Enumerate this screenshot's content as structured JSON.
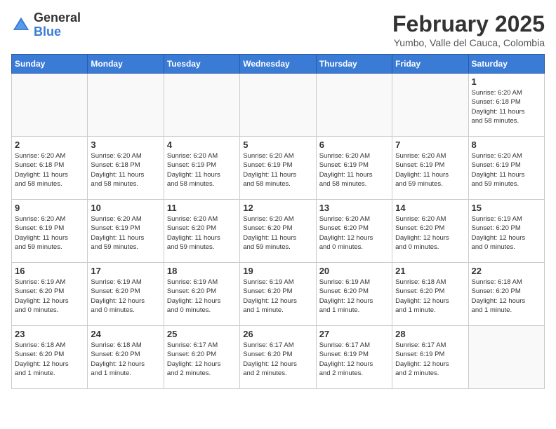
{
  "header": {
    "logo": {
      "general": "General",
      "blue": "Blue"
    },
    "title": "February 2025",
    "subtitle": "Yumbo, Valle del Cauca, Colombia"
  },
  "weekdays": [
    "Sunday",
    "Monday",
    "Tuesday",
    "Wednesday",
    "Thursday",
    "Friday",
    "Saturday"
  ],
  "weeks": [
    [
      {
        "day": "",
        "info": ""
      },
      {
        "day": "",
        "info": ""
      },
      {
        "day": "",
        "info": ""
      },
      {
        "day": "",
        "info": ""
      },
      {
        "day": "",
        "info": ""
      },
      {
        "day": "",
        "info": ""
      },
      {
        "day": "1",
        "info": "Sunrise: 6:20 AM\nSunset: 6:18 PM\nDaylight: 11 hours\nand 58 minutes."
      }
    ],
    [
      {
        "day": "2",
        "info": "Sunrise: 6:20 AM\nSunset: 6:18 PM\nDaylight: 11 hours\nand 58 minutes."
      },
      {
        "day": "3",
        "info": "Sunrise: 6:20 AM\nSunset: 6:18 PM\nDaylight: 11 hours\nand 58 minutes."
      },
      {
        "day": "4",
        "info": "Sunrise: 6:20 AM\nSunset: 6:19 PM\nDaylight: 11 hours\nand 58 minutes."
      },
      {
        "day": "5",
        "info": "Sunrise: 6:20 AM\nSunset: 6:19 PM\nDaylight: 11 hours\nand 58 minutes."
      },
      {
        "day": "6",
        "info": "Sunrise: 6:20 AM\nSunset: 6:19 PM\nDaylight: 11 hours\nand 58 minutes."
      },
      {
        "day": "7",
        "info": "Sunrise: 6:20 AM\nSunset: 6:19 PM\nDaylight: 11 hours\nand 59 minutes."
      },
      {
        "day": "8",
        "info": "Sunrise: 6:20 AM\nSunset: 6:19 PM\nDaylight: 11 hours\nand 59 minutes."
      }
    ],
    [
      {
        "day": "9",
        "info": "Sunrise: 6:20 AM\nSunset: 6:19 PM\nDaylight: 11 hours\nand 59 minutes."
      },
      {
        "day": "10",
        "info": "Sunrise: 6:20 AM\nSunset: 6:19 PM\nDaylight: 11 hours\nand 59 minutes."
      },
      {
        "day": "11",
        "info": "Sunrise: 6:20 AM\nSunset: 6:20 PM\nDaylight: 11 hours\nand 59 minutes."
      },
      {
        "day": "12",
        "info": "Sunrise: 6:20 AM\nSunset: 6:20 PM\nDaylight: 11 hours\nand 59 minutes."
      },
      {
        "day": "13",
        "info": "Sunrise: 6:20 AM\nSunset: 6:20 PM\nDaylight: 12 hours\nand 0 minutes."
      },
      {
        "day": "14",
        "info": "Sunrise: 6:20 AM\nSunset: 6:20 PM\nDaylight: 12 hours\nand 0 minutes."
      },
      {
        "day": "15",
        "info": "Sunrise: 6:19 AM\nSunset: 6:20 PM\nDaylight: 12 hours\nand 0 minutes."
      }
    ],
    [
      {
        "day": "16",
        "info": "Sunrise: 6:19 AM\nSunset: 6:20 PM\nDaylight: 12 hours\nand 0 minutes."
      },
      {
        "day": "17",
        "info": "Sunrise: 6:19 AM\nSunset: 6:20 PM\nDaylight: 12 hours\nand 0 minutes."
      },
      {
        "day": "18",
        "info": "Sunrise: 6:19 AM\nSunset: 6:20 PM\nDaylight: 12 hours\nand 0 minutes."
      },
      {
        "day": "19",
        "info": "Sunrise: 6:19 AM\nSunset: 6:20 PM\nDaylight: 12 hours\nand 1 minute."
      },
      {
        "day": "20",
        "info": "Sunrise: 6:19 AM\nSunset: 6:20 PM\nDaylight: 12 hours\nand 1 minute."
      },
      {
        "day": "21",
        "info": "Sunrise: 6:18 AM\nSunset: 6:20 PM\nDaylight: 12 hours\nand 1 minute."
      },
      {
        "day": "22",
        "info": "Sunrise: 6:18 AM\nSunset: 6:20 PM\nDaylight: 12 hours\nand 1 minute."
      }
    ],
    [
      {
        "day": "23",
        "info": "Sunrise: 6:18 AM\nSunset: 6:20 PM\nDaylight: 12 hours\nand 1 minute."
      },
      {
        "day": "24",
        "info": "Sunrise: 6:18 AM\nSunset: 6:20 PM\nDaylight: 12 hours\nand 1 minute."
      },
      {
        "day": "25",
        "info": "Sunrise: 6:17 AM\nSunset: 6:20 PM\nDaylight: 12 hours\nand 2 minutes."
      },
      {
        "day": "26",
        "info": "Sunrise: 6:17 AM\nSunset: 6:20 PM\nDaylight: 12 hours\nand 2 minutes."
      },
      {
        "day": "27",
        "info": "Sunrise: 6:17 AM\nSunset: 6:19 PM\nDaylight: 12 hours\nand 2 minutes."
      },
      {
        "day": "28",
        "info": "Sunrise: 6:17 AM\nSunset: 6:19 PM\nDaylight: 12 hours\nand 2 minutes."
      },
      {
        "day": "",
        "info": ""
      }
    ]
  ]
}
